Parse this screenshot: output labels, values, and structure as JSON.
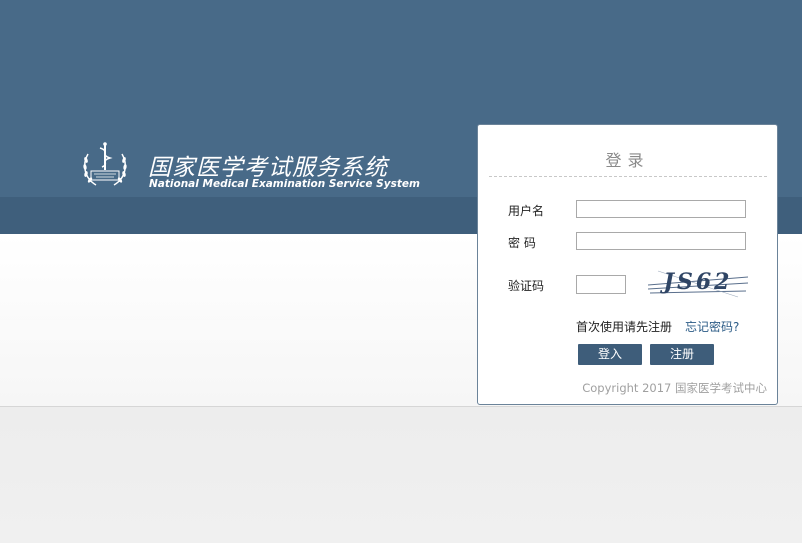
{
  "header": {
    "title_cn": "国家医学考试服务系统",
    "title_en": "National Medical Examination Service System",
    "logo_icon": "caduceus-wreath-emblem-icon"
  },
  "login": {
    "title": "登录",
    "username_label": "用户名",
    "username_value": "",
    "password_label": "密 码",
    "password_value": "",
    "captcha_label": "验证码",
    "captcha_value": "",
    "captcha_text": "JS62",
    "first_use_text": "首次使用请先注册",
    "forgot_link": "忘记密码?",
    "login_button": "登入",
    "register_button": "注册",
    "copyright": "Copyright 2017 国家医学考试中心"
  },
  "colors": {
    "header_bg": "#486a88",
    "header_band": "#3f5f7c",
    "button_bg": "#3e5d7a",
    "link": "#2b5b86"
  }
}
